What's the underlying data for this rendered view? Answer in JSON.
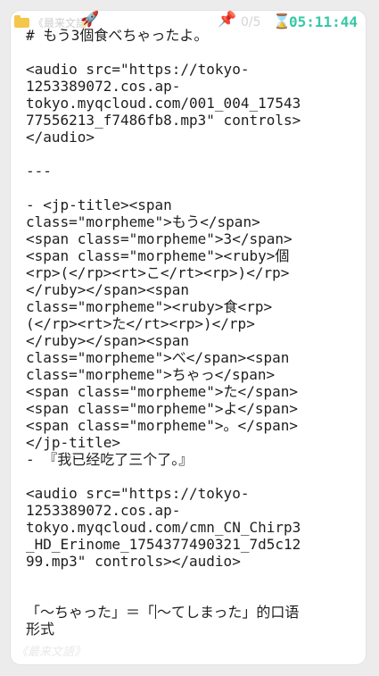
{
  "statusbar": {
    "folder_icon": "folder-icon",
    "book_label": "《最来文語》",
    "rocket_icon": "rocket-icon",
    "pin_icon": "pushpin-icon",
    "progress": "0/5",
    "hourglass_icon": "hourglass-icon",
    "clock": "05:11:44"
  },
  "editor": {
    "lines": [
      "# もう3個食べちゃったよ。",
      "",
      "<audio src=\"https://tokyo-",
      "1253389072.cos.ap-",
      "tokyo.myqcloud.com/001_004_17543",
      "77556213_f7486fb8.mp3\" controls>",
      "</audio>",
      "",
      "---",
      "",
      "- <jp-title><span",
      "class=\"morpheme\">もう</span>",
      "<span class=\"morpheme\">3</span>",
      "<span class=\"morpheme\"><ruby>個",
      "<rp>(</rp><rt>こ</rt><rp>)</rp>",
      "</ruby></span><span",
      "class=\"morpheme\"><ruby>食<rp>",
      "(</rp><rt>た</rt><rp>)</rp>",
      "</ruby></span><span",
      "class=\"morpheme\">べ</span><span",
      "class=\"morpheme\">ちゃっ</span>",
      "<span class=\"morpheme\">た</span>",
      "<span class=\"morpheme\">よ</span>",
      "<span class=\"morpheme\">。</span>",
      "</jp-title>",
      "- 『我已经吃了三个了。』",
      "",
      "<audio src=\"https://tokyo-",
      "1253389072.cos.ap-",
      "tokyo.myqcloud.com/cmn_CN_Chirp3",
      "_HD_Erinome_1754377490321_7d5c12",
      "99.mp3\" controls></audio>",
      "",
      "",
      "「〜ちゃった」＝「〜てしまった」的口语",
      "形式"
    ]
  },
  "footer": {
    "book_title": "《最来文語》"
  }
}
